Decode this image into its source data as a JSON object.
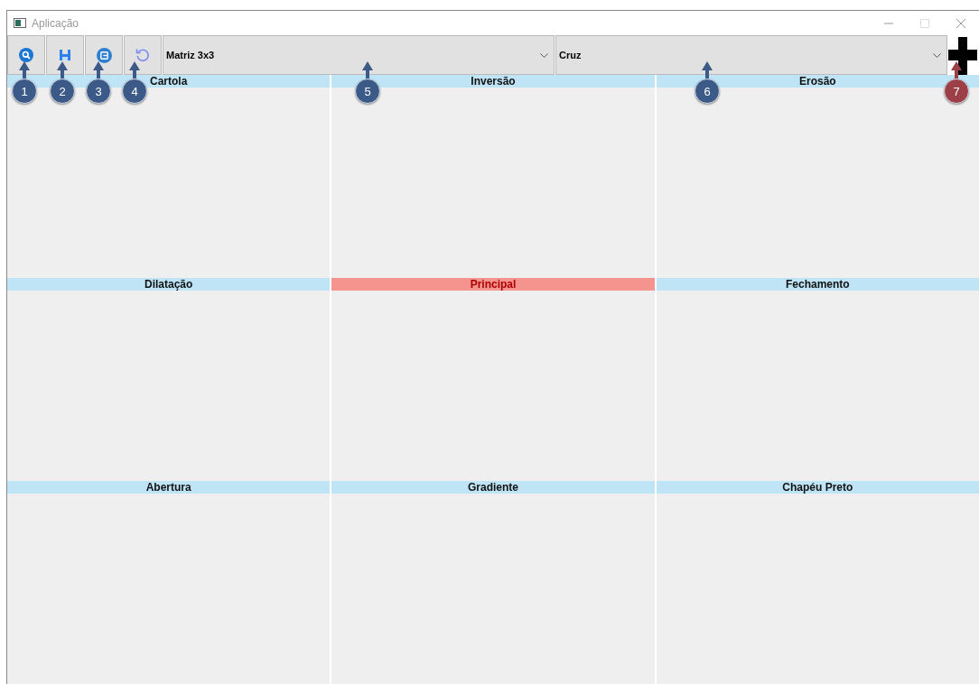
{
  "window": {
    "title": "Aplicação"
  },
  "toolbar": {
    "buttons": [
      {
        "kind": "search"
      },
      {
        "kind": "save"
      },
      {
        "kind": "export"
      },
      {
        "kind": "undo"
      }
    ],
    "dropdowns": [
      {
        "value": "Matriz 3x3"
      },
      {
        "value": "Cruz"
      }
    ],
    "preview": {
      "kind": "cross"
    }
  },
  "panels": [
    {
      "title": "Cartola",
      "selected": false
    },
    {
      "title": "Inversão",
      "selected": false
    },
    {
      "title": "Erosão",
      "selected": false
    },
    {
      "title": "Dilatação",
      "selected": false
    },
    {
      "title": "Principal",
      "selected": true
    },
    {
      "title": "Fechamento",
      "selected": false
    },
    {
      "title": "Abertura",
      "selected": false
    },
    {
      "title": "Gradiente",
      "selected": false
    },
    {
      "title": "Chapéu Preto",
      "selected": false
    }
  ],
  "callouts": [
    {
      "number": "1",
      "color": "#3b5a88"
    },
    {
      "number": "2",
      "color": "#3b5a88"
    },
    {
      "number": "3",
      "color": "#3b5a88"
    },
    {
      "number": "4",
      "color": "#3b5a88"
    },
    {
      "number": "5",
      "color": "#3b5a88"
    },
    {
      "number": "6",
      "color": "#3b5a88"
    },
    {
      "number": "7",
      "color": "#9c3f47"
    }
  ]
}
